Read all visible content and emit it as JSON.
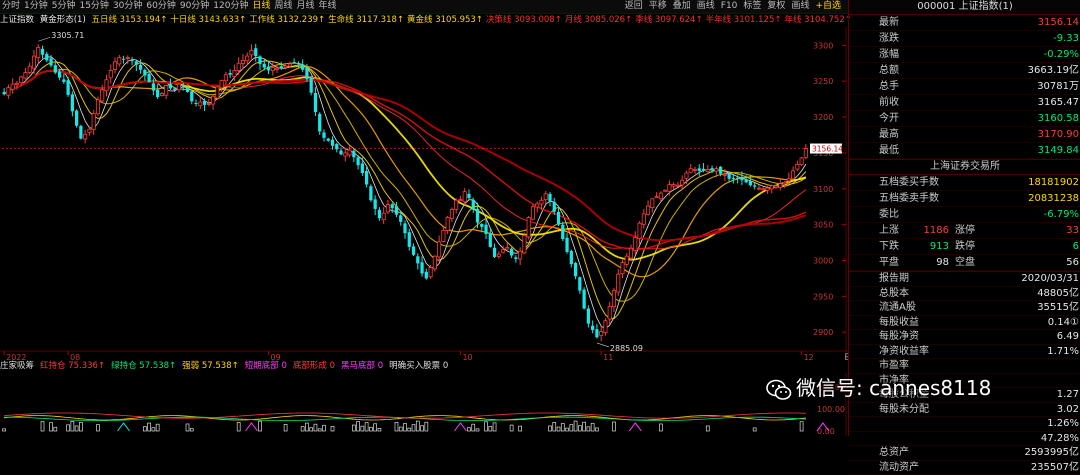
{
  "toolbar": {
    "periods": [
      "分时",
      "1分钟",
      "5分钟",
      "15分钟",
      "30分钟",
      "60分钟",
      "90分钟",
      "120分钟",
      "日线",
      "周线",
      "月线",
      "年线"
    ],
    "active_period": "日线",
    "actions": [
      "返回",
      "平移",
      "叠加",
      "画线",
      "F10",
      "标签",
      "复权",
      "画线",
      "+自选"
    ]
  },
  "legend": {
    "title": "上证指数",
    "indicator": "黄金形态(1)",
    "items": [
      {
        "text": "五日线 3153.194↑",
        "color": "#ffd700"
      },
      {
        "text": "十日线 3143.633↑",
        "color": "#ffd700"
      },
      {
        "text": "工作线 3132.239↑",
        "color": "#ffd700"
      },
      {
        "text": "生命线 3117.318↑",
        "color": "#ffd700"
      },
      {
        "text": "黄金线 3105.953↑",
        "color": "#ffd700"
      },
      {
        "text": "决策线 3093.008↑",
        "color": "#ff2a2a"
      },
      {
        "text": "月线 3085.026↑",
        "color": "#ff2a2a"
      },
      {
        "text": "季线 3097.624↑",
        "color": "#ff2a2a"
      },
      {
        "text": "半年线 3101.125↑",
        "color": "#ff2a2a"
      },
      {
        "text": "年线 3104.752↑",
        "color": "#ff2a2a"
      }
    ]
  },
  "chart_data": {
    "type": "candlestick",
    "ylim": [
      2885,
      3320
    ],
    "yticks": [
      3300,
      3250,
      3200,
      3150,
      3100,
      3050,
      3000,
      2950,
      2900
    ],
    "xlabels": [
      {
        "label": "2022",
        "bar": 0
      },
      {
        "label": "08",
        "bar": 15
      },
      {
        "label": "09",
        "bar": 62
      },
      {
        "label": "10",
        "bar": 107
      },
      {
        "label": "11",
        "bar": 140
      },
      {
        "label": "12",
        "bar": 187
      }
    ],
    "annotations": [
      {
        "text": "3305.71",
        "bar": 8,
        "value": 3305.71
      },
      {
        "text": "2885.09",
        "bar": 139,
        "value": 2885.09
      },
      {
        "text": "3156.14",
        "value": 3156.14
      }
    ],
    "last_price": 3156.14,
    "closes": [
      3232,
      3241,
      3246,
      3247,
      3256,
      3262,
      3271,
      3285,
      3297,
      3287,
      3279,
      3272,
      3262,
      3255,
      3249,
      3231,
      3208,
      3188,
      3170,
      3176,
      3183,
      3205,
      3224,
      3238,
      3252,
      3265,
      3277,
      3283,
      3281,
      3283,
      3278,
      3273,
      3266,
      3258,
      3249,
      3237,
      3228,
      3233,
      3244,
      3240,
      3238,
      3246,
      3244,
      3235,
      3222,
      3219,
      3221,
      3217,
      3219,
      3229,
      3242,
      3251,
      3259,
      3259,
      3265,
      3275,
      3279,
      3285,
      3293,
      3285,
      3274,
      3269,
      3265,
      3269,
      3268,
      3268,
      3271,
      3274,
      3276,
      3275,
      3266,
      3253,
      3234,
      3207,
      3180,
      3171,
      3167,
      3160,
      3155,
      3148,
      3150,
      3154,
      3144,
      3133,
      3122,
      3106,
      3084,
      3072,
      3059,
      3066,
      3078,
      3073,
      3064,
      3054,
      3038,
      3019,
      3008,
      2996,
      2982,
      2975,
      2990,
      3006,
      3026,
      3042,
      3060,
      3071,
      3084,
      3085,
      3096,
      3087,
      3071,
      3053,
      3047,
      3037,
      3019,
      3005,
      3009,
      3015,
      3018,
      3007,
      3002,
      3013,
      3035,
      3060,
      3075,
      3079,
      3084,
      3093,
      3083,
      3068,
      3050,
      3030,
      3012,
      2995,
      2978,
      2958,
      2933,
      2912,
      2903,
      2893,
      2901,
      2916,
      2936,
      2958,
      2981,
      2997,
      3006,
      3017,
      3032,
      3052,
      3065,
      3076,
      3086,
      3089,
      3094,
      3098,
      3106,
      3106,
      3105,
      3112,
      3122,
      3128,
      3127,
      3125,
      3126,
      3127,
      3126,
      3128,
      3121,
      3120,
      3114,
      3115,
      3115,
      3112,
      3109,
      3105,
      3103,
      3101,
      3100,
      3101,
      3104,
      3104,
      3107,
      3109,
      3114,
      3125,
      3134,
      3143,
      3156.14
    ]
  },
  "sub_legend": {
    "items": [
      {
        "text": "庄家吸筹",
        "color": "#ddd"
      },
      {
        "text": "红持仓 75.336↑",
        "color": "#ff3b3b"
      },
      {
        "text": "绿持仓 57.538↑",
        "color": "#00e676"
      },
      {
        "text": "强弱 57.538↑",
        "color": "#ffd700"
      },
      {
        "text": "短期底部 0",
        "color": "#ff3bff"
      },
      {
        "text": "底部形成 0",
        "color": "#ff3b3b"
      },
      {
        "text": "黑马底部 0",
        "color": "#ff3bff"
      },
      {
        "text": "明确买入股票 0",
        "color": "#ddd"
      }
    ],
    "yticks": [
      200,
      100,
      0
    ]
  },
  "axis": {
    "period_label": "日线"
  },
  "panel": {
    "code_name": "000001 上证指数(1)",
    "quote": [
      {
        "k": "最新",
        "v": "3156.14",
        "c": "up"
      },
      {
        "k": "涨跌",
        "v": "-9.33",
        "c": "dn"
      },
      {
        "k": "涨幅",
        "v": "-0.29%",
        "c": "dn"
      },
      {
        "k": "总额",
        "v": "3663.19亿",
        "c": "wt"
      },
      {
        "k": "总手",
        "v": "30781万",
        "c": "wt"
      },
      {
        "k": "前收",
        "v": "3165.47",
        "c": "wt"
      },
      {
        "k": "今开",
        "v": "3160.58",
        "c": "dn"
      },
      {
        "k": "最高",
        "v": "3170.90",
        "c": "up"
      },
      {
        "k": "最低",
        "v": "3149.84",
        "c": "dn"
      }
    ],
    "exchange": "上海证券交易所",
    "orders": [
      {
        "k": "五档委买手数",
        "v": "18181902",
        "c": "yl"
      },
      {
        "k": "五档委卖手数",
        "v": "20831238",
        "c": "yl"
      },
      {
        "k": "委比",
        "v": "-6.79%",
        "c": "dn"
      }
    ],
    "breadth": [
      {
        "k": "上涨",
        "v": "1186",
        "c": "up",
        "k2": "涨停",
        "v2": "33",
        "c2": "up"
      },
      {
        "k": "下跌",
        "v": "913",
        "c": "dn",
        "k2": "跌停",
        "v2": "6",
        "c2": "dn"
      },
      {
        "k": "平盘",
        "v": "98",
        "c": "wt",
        "k2": "空盘",
        "v2": "56",
        "c2": "wt"
      }
    ],
    "fundamentals": [
      {
        "k": "报告期",
        "v": "2020/03/31"
      },
      {
        "k": "总股本",
        "v": "48805亿"
      },
      {
        "k": "流通A股",
        "v": "35515亿"
      },
      {
        "k": "每股收益",
        "v": "0.14①"
      },
      {
        "k": "每股净资",
        "v": "6.49"
      },
      {
        "k": "净资收益率",
        "v": "1.71%"
      },
      {
        "k": "市盈率",
        "v": ""
      },
      {
        "k": "市净率",
        "v": ""
      },
      {
        "k": "每股公积金",
        "v": "1.27"
      },
      {
        "k": "每股未分配",
        "v": "3.02"
      },
      {
        "k": "",
        "v": "1.26%"
      },
      {
        "k": "",
        "v": "47.28%"
      },
      {
        "k": "总资产",
        "v": "2593995亿"
      },
      {
        "k": "流动资产",
        "v": "235507亿"
      }
    ]
  },
  "watermark": {
    "text": "微信号: cannes8118"
  }
}
